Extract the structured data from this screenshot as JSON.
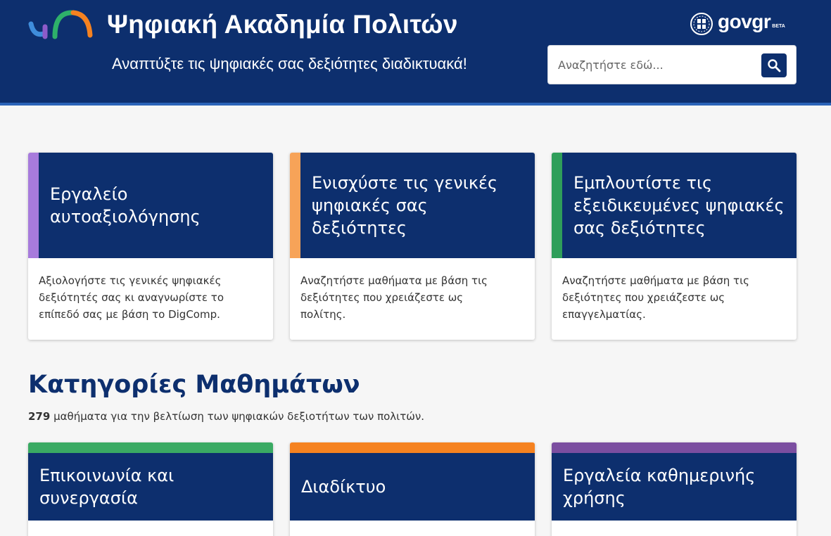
{
  "header": {
    "site_title": "Ψηφιακή Ακαδημία Πολιτών",
    "tagline": "Αναπτύξτε τις ψηφιακές σας δεξιότητες διαδικτυακά!",
    "gov_logo_text": "govgr",
    "gov_logo_badge": "BETA",
    "search": {
      "placeholder": "Αναζητήστε εδώ..."
    }
  },
  "feature_cards": [
    {
      "title": "Εργαλείο αυτοαξιολόγησης",
      "description": "Αξιολογήστε τις γενικές ψηφιακές δεξιότητές σας κι αναγνωρίστε το επίπεδό σας με βάση το DigComp.",
      "accent": "#a77bdc"
    },
    {
      "title": "Ενισχύστε τις γενικές ψηφιακές σας δεξιότητες",
      "description": "Αναζητήστε μαθήματα με βάση τις δεξιότητες που χρειάζεστε ως πολίτης.",
      "accent": "#f7a358"
    },
    {
      "title": "Εμπλουτίστε τις εξειδικευμένες ψηφιακές σας δεξιότητες",
      "description": "Αναζητήστε μαθήματα με βάση τις δεξιότητες που χρειάζεστε ως επαγγελματίας.",
      "accent": "#2f9e5a"
    }
  ],
  "categories_section": {
    "title": "Κατηγορίες Μαθημάτων",
    "course_count": "279",
    "subtitle_rest": " μαθήματα για την βελτίωση των ψηφιακών δεξιοτήτων των πολιτών."
  },
  "categories": [
    {
      "title": "Επικοινωνία και συνεργασία",
      "color": "#3aaa63"
    },
    {
      "title": "Διαδίκτυο",
      "color": "#f58220"
    },
    {
      "title": "Εργαλεία καθημερινής χρήσης",
      "color": "#7b4ea0"
    }
  ],
  "colors": {
    "header_bg": "#0d2f6e",
    "header_line": "#2b64b8",
    "page_bg": "#f6f6f6"
  },
  "icons": {
    "search": "search-icon",
    "logo": "academy-logo-icon",
    "emblem": "greek-emblem-icon"
  }
}
